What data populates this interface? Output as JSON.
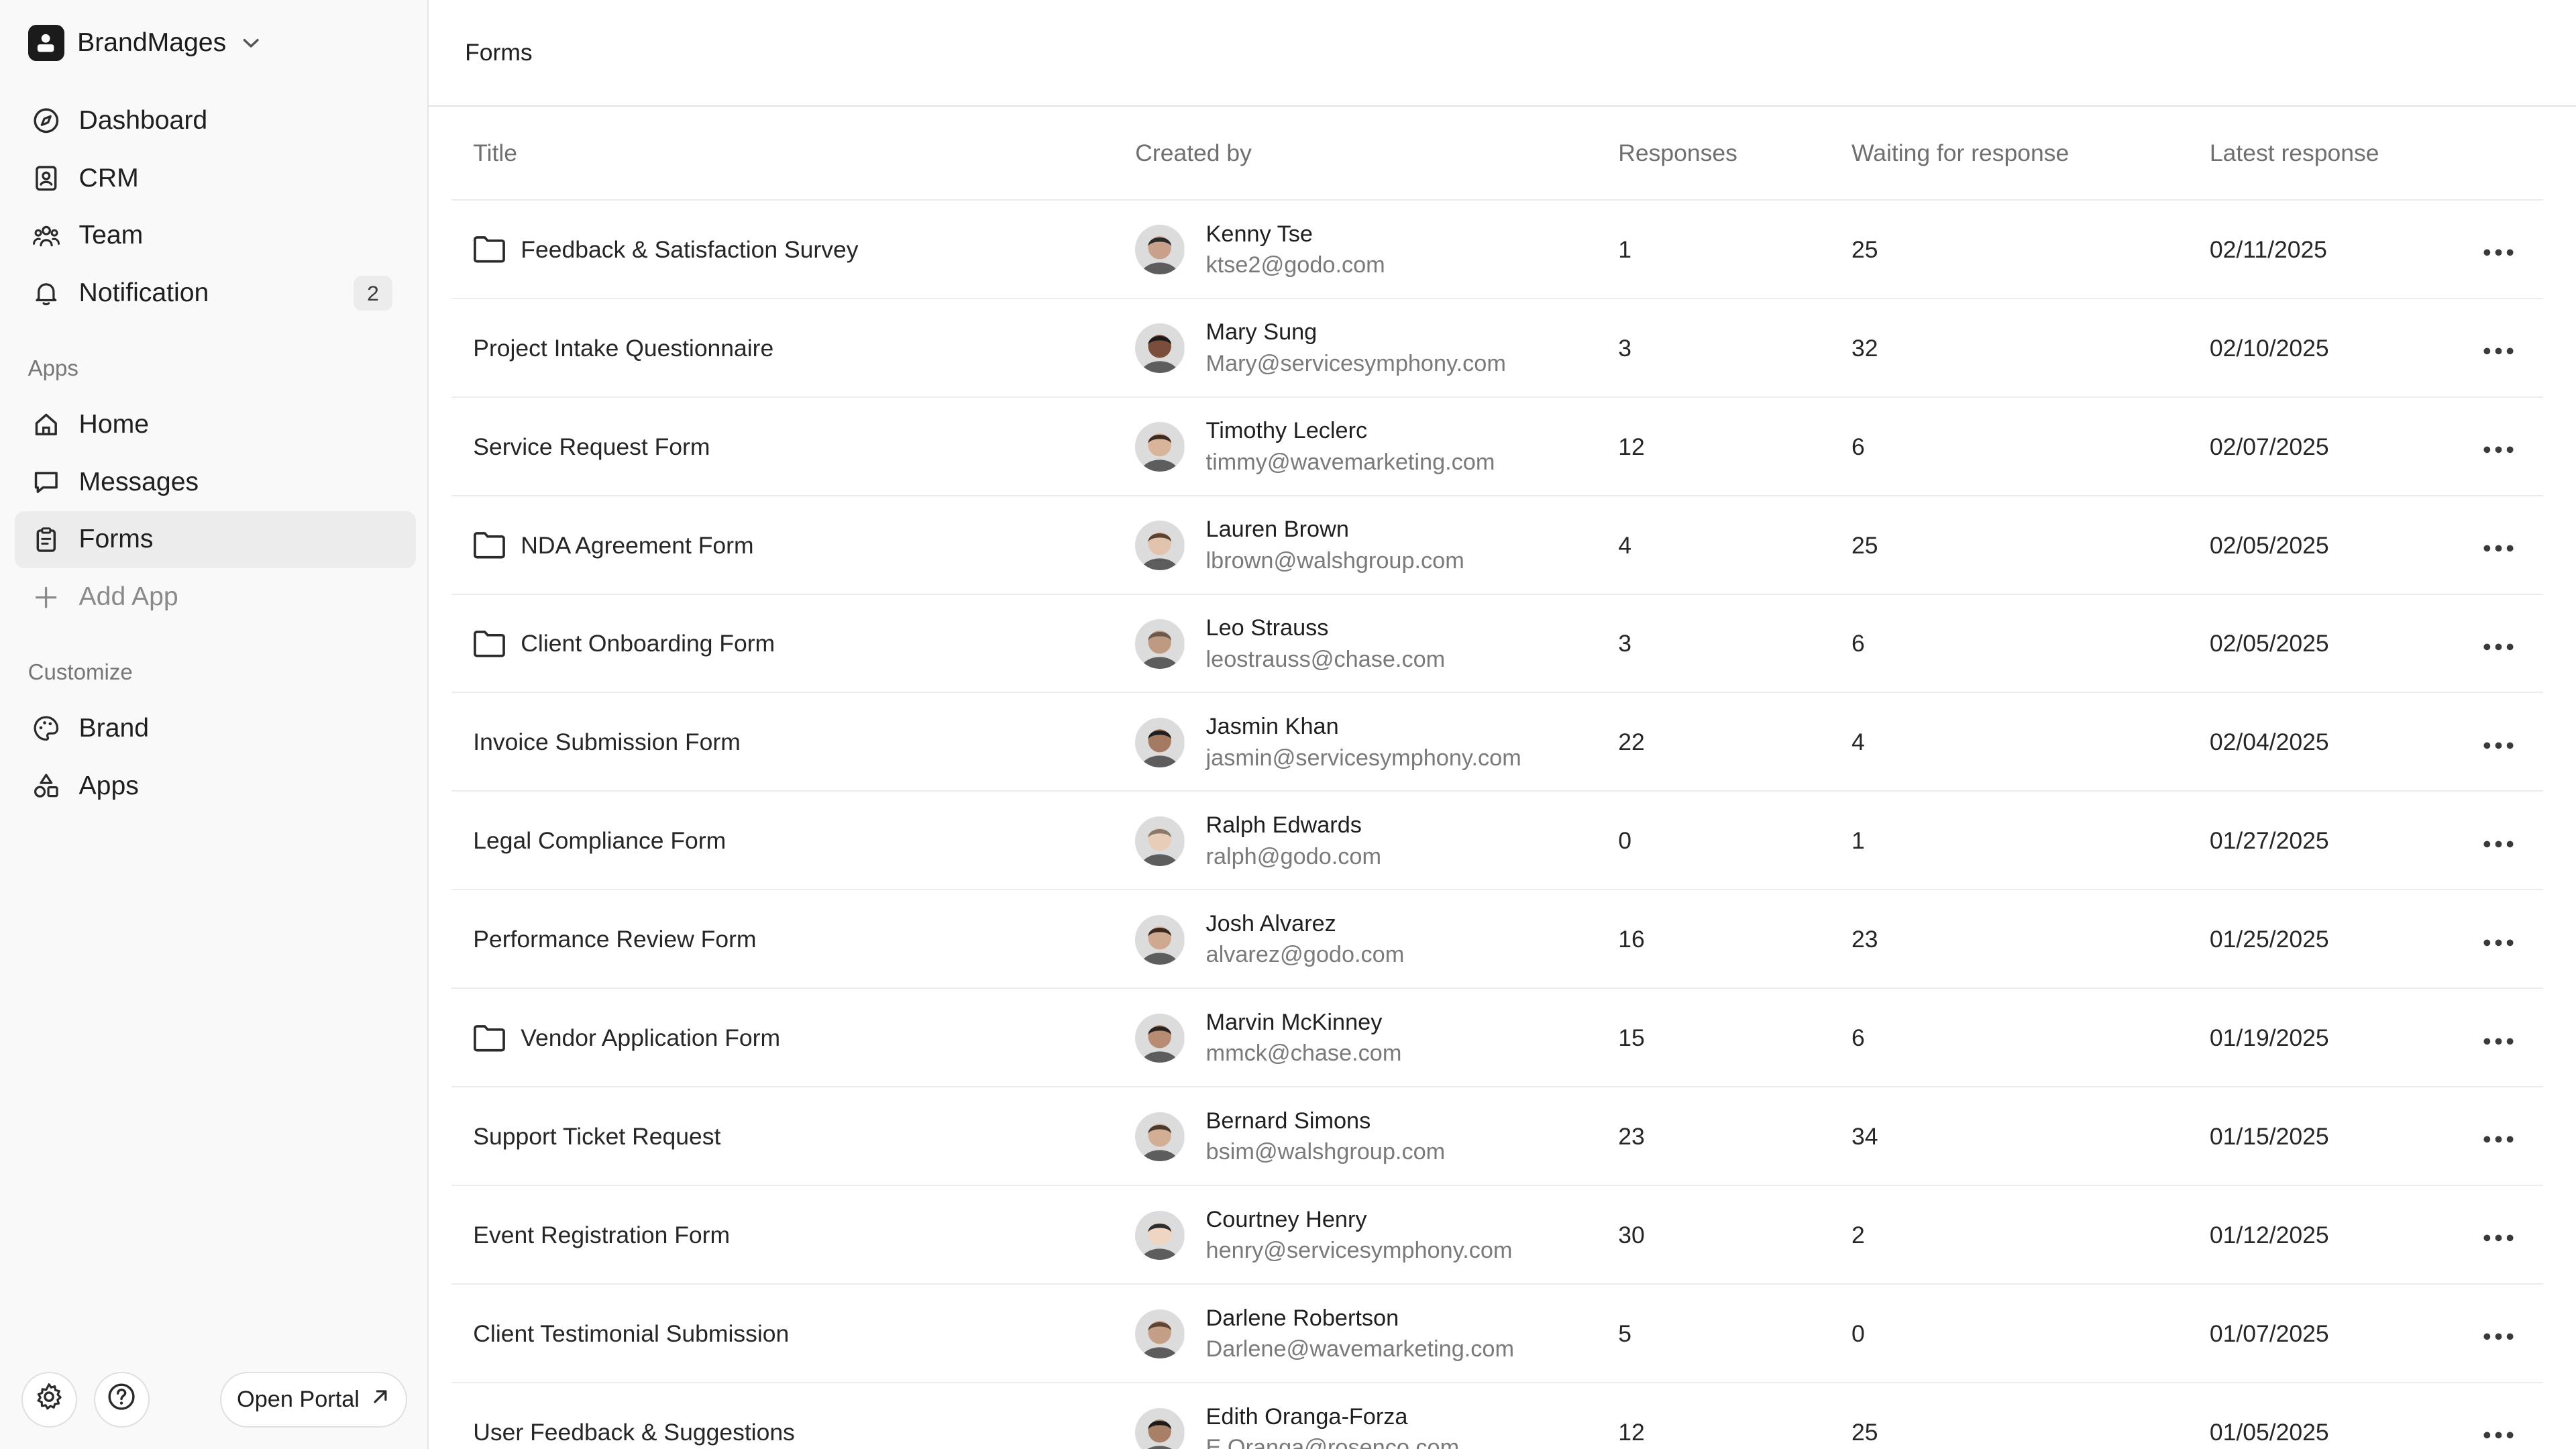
{
  "workspace": {
    "name": "BrandMages"
  },
  "sidebar": {
    "main_items": [
      {
        "label": "Dashboard",
        "icon": "compass-icon"
      },
      {
        "label": "CRM",
        "icon": "contact-book-icon"
      },
      {
        "label": "Team",
        "icon": "team-icon"
      },
      {
        "label": "Notification",
        "icon": "bell-icon",
        "badge": "2"
      }
    ],
    "apps_label": "Apps",
    "app_items": [
      {
        "label": "Home",
        "icon": "home-icon"
      },
      {
        "label": "Messages",
        "icon": "message-icon"
      },
      {
        "label": "Forms",
        "icon": "clipboard-icon",
        "active": true
      },
      {
        "label": "Add App",
        "icon": "plus-icon"
      }
    ],
    "customize_label": "Customize",
    "customize_items": [
      {
        "label": "Brand",
        "icon": "palette-icon"
      },
      {
        "label": "Apps",
        "icon": "shapes-icon"
      }
    ],
    "open_portal_label": "Open Portal"
  },
  "header": {
    "title": "Forms"
  },
  "table": {
    "columns": {
      "title": "Title",
      "created_by": "Created by",
      "responses": "Responses",
      "waiting": "Waiting for response",
      "latest": "Latest response"
    },
    "rows": [
      {
        "title": "Feedback & Satisfaction Survey",
        "folder": true,
        "name": "Kenny Tse",
        "email": "ktse2@godo.com",
        "responses": "1",
        "waiting": "25",
        "latest": "02/11/2025"
      },
      {
        "title": "Project Intake Questionnaire",
        "folder": false,
        "name": "Mary Sung",
        "email": "Mary@servicesymphony.com",
        "responses": "3",
        "waiting": "32",
        "latest": "02/10/2025"
      },
      {
        "title": "Service Request Form",
        "folder": false,
        "name": "Timothy Leclerc",
        "email": "timmy@wavemarketing.com",
        "responses": "12",
        "waiting": "6",
        "latest": "02/07/2025"
      },
      {
        "title": "NDA Agreement Form",
        "folder": true,
        "name": "Lauren Brown",
        "email": "lbrown@walshgroup.com",
        "responses": "4",
        "waiting": "25",
        "latest": "02/05/2025"
      },
      {
        "title": "Client Onboarding Form",
        "folder": true,
        "name": "Leo Strauss",
        "email": "leostrauss@chase.com",
        "responses": "3",
        "waiting": "6",
        "latest": "02/05/2025"
      },
      {
        "title": "Invoice Submission Form",
        "folder": false,
        "name": "Jasmin Khan",
        "email": "jasmin@servicesymphony.com",
        "responses": "22",
        "waiting": "4",
        "latest": "02/04/2025"
      },
      {
        "title": "Legal Compliance Form",
        "folder": false,
        "name": "Ralph Edwards",
        "email": "ralph@godo.com",
        "responses": "0",
        "waiting": "1",
        "latest": "01/27/2025"
      },
      {
        "title": "Performance Review Form",
        "folder": false,
        "name": "Josh Alvarez",
        "email": "alvarez@godo.com",
        "responses": "16",
        "waiting": "23",
        "latest": "01/25/2025"
      },
      {
        "title": "Vendor Application Form",
        "folder": true,
        "name": "Marvin McKinney",
        "email": "mmck@chase.com",
        "responses": "15",
        "waiting": "6",
        "latest": "01/19/2025"
      },
      {
        "title": "Support Ticket Request",
        "folder": false,
        "name": "Bernard Simons",
        "email": "bsim@walshgroup.com",
        "responses": "23",
        "waiting": "34",
        "latest": "01/15/2025"
      },
      {
        "title": "Event Registration Form",
        "folder": false,
        "name": "Courtney Henry",
        "email": "henry@servicesymphony.com",
        "responses": "30",
        "waiting": "2",
        "latest": "01/12/2025"
      },
      {
        "title": "Client Testimonial Submission",
        "folder": false,
        "name": "Darlene Robertson",
        "email": "Darlene@wavemarketing.com",
        "responses": "5",
        "waiting": "0",
        "latest": "01/07/2025"
      },
      {
        "title": "User Feedback & Suggestions",
        "folder": false,
        "name": "Edith Oranga-Forza",
        "email": "E.Oranga@rosenco.com",
        "responses": "12",
        "waiting": "25",
        "latest": "01/05/2025"
      }
    ]
  },
  "colors": {
    "sidebar_bg": "#f9f9f9",
    "active_item_bg": "#ececec",
    "border": "#e4e4e4",
    "text_muted": "#7a7a7a"
  }
}
